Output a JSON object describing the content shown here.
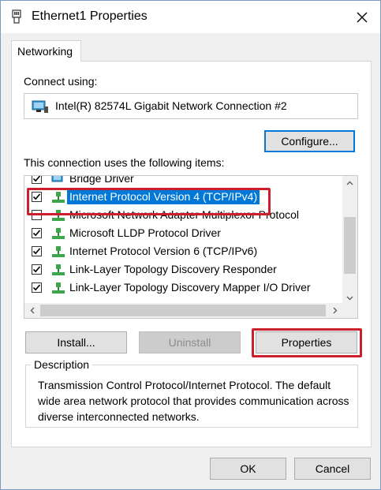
{
  "window": {
    "title": "Ethernet1 Properties"
  },
  "tabs": [
    {
      "label": "Networking"
    }
  ],
  "connect_using": {
    "label": "Connect using:",
    "adapter_name": "Intel(R) 82574L Gigabit Network Connection #2"
  },
  "buttons": {
    "configure": "Configure...",
    "install": "Install...",
    "uninstall": "Uninstall",
    "properties": "Properties",
    "ok": "OK",
    "cancel": "Cancel"
  },
  "items_label": "This connection uses the following items:",
  "items": [
    {
      "label": "Bridge Driver",
      "checked": true,
      "icon": "bridge-icon"
    },
    {
      "label": "Internet Protocol Version 4 (TCP/IPv4)",
      "checked": true,
      "icon": "protocol-icon",
      "selected": true
    },
    {
      "label": "Microsoft Network Adapter Multiplexor Protocol",
      "checked": false,
      "icon": "protocol-icon"
    },
    {
      "label": "Microsoft LLDP Protocol Driver",
      "checked": true,
      "icon": "protocol-icon"
    },
    {
      "label": "Internet Protocol Version 6 (TCP/IPv6)",
      "checked": true,
      "icon": "protocol-icon"
    },
    {
      "label": "Link-Layer Topology Discovery Responder",
      "checked": true,
      "icon": "protocol-icon"
    },
    {
      "label": "Link-Layer Topology Discovery Mapper I/O Driver",
      "checked": true,
      "icon": "protocol-icon"
    }
  ],
  "description": {
    "title": "Description",
    "text": "Transmission Control Protocol/Internet Protocol. The default wide area network protocol that provides communication across diverse interconnected networks."
  },
  "colors": {
    "accent": "#0078d7",
    "highlight_box": "#cc1f2d"
  }
}
